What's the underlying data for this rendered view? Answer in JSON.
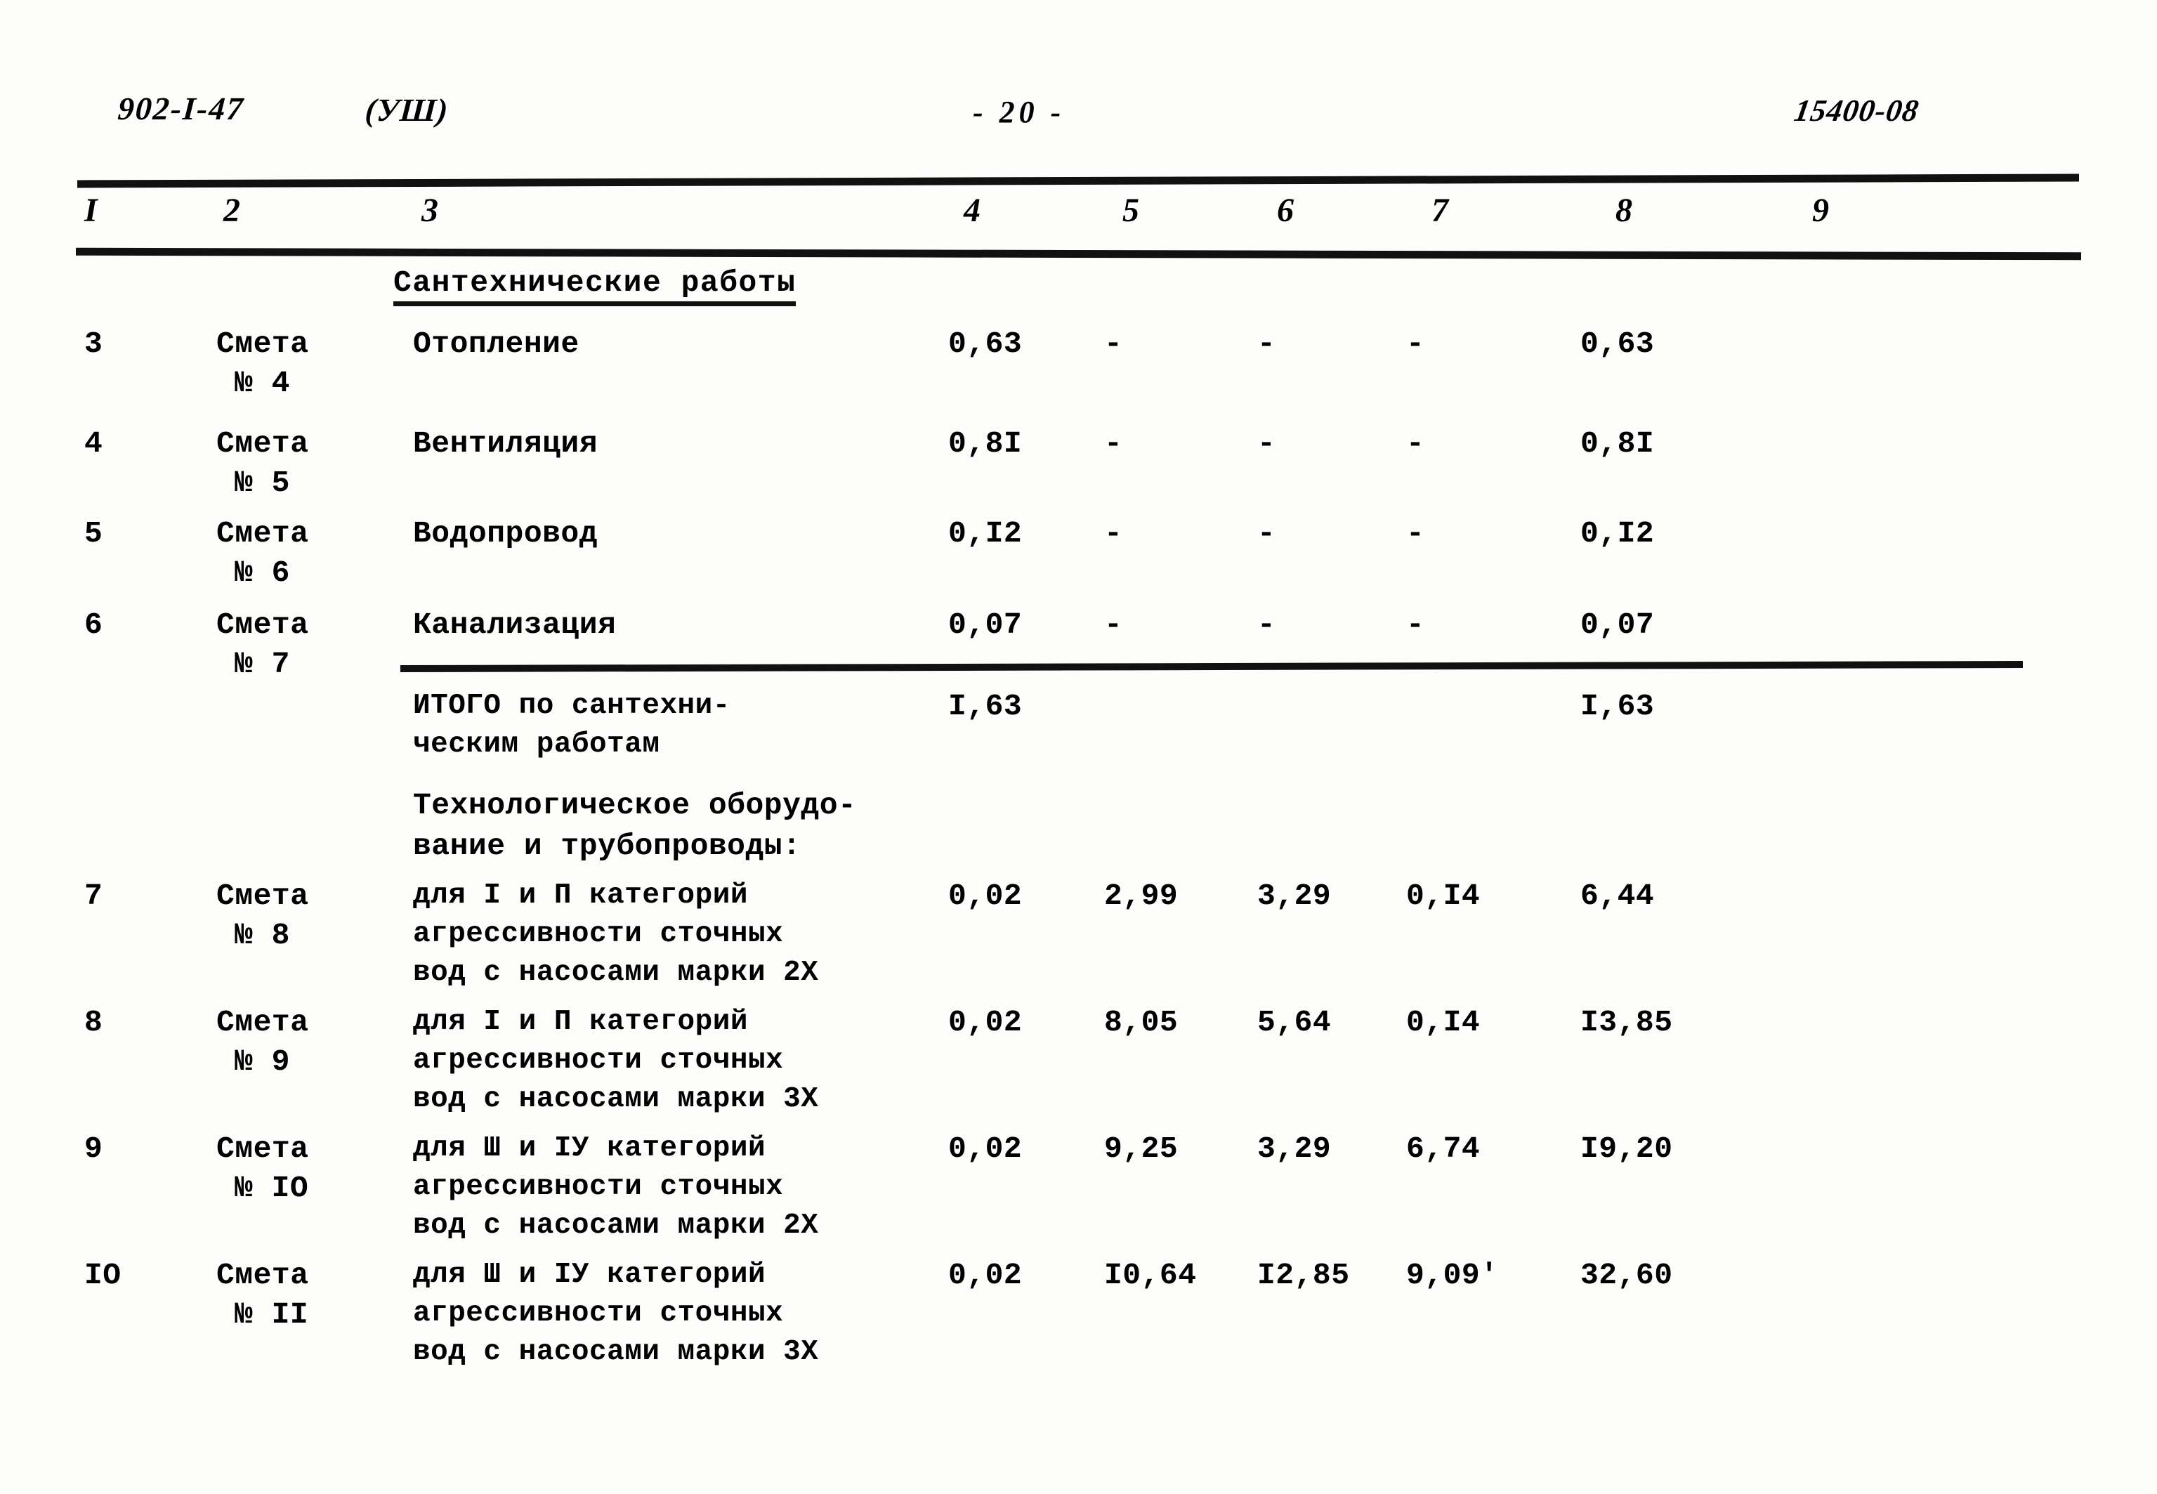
{
  "header": {
    "doc_code": "902-I-47",
    "series": "(УШ)",
    "page_number": "- 20 -",
    "stamp": "15400-08"
  },
  "table": {
    "column_headers": [
      "I",
      "2",
      "3",
      "4",
      "5",
      "6",
      "7",
      "8",
      "9"
    ],
    "section_title": "Сантехнические работы",
    "rows": [
      {
        "num": "3",
        "estimate_l1": "Смета",
        "estimate_l2": "№ 4",
        "desc": "Отопление",
        "c4": "0,63",
        "c5": "-",
        "c6": "-",
        "c7": "-",
        "c8": "0,63",
        "c9": ""
      },
      {
        "num": "4",
        "estimate_l1": "Смета",
        "estimate_l2": "№ 5",
        "desc": "Вентиляция",
        "c4": "0,8I",
        "c5": "-",
        "c6": "-",
        "c7": "-",
        "c8": "0,8I",
        "c9": ""
      },
      {
        "num": "5",
        "estimate_l1": "Смета",
        "estimate_l2": "№ 6",
        "desc": "Водопровод",
        "c4": "0,I2",
        "c5": "-",
        "c6": "-",
        "c7": "-",
        "c8": "0,I2",
        "c9": ""
      },
      {
        "num": "6",
        "estimate_l1": "Смета",
        "estimate_l2": "№ 7",
        "desc": "Канализация",
        "c4": "0,07",
        "c5": "-",
        "c6": "-",
        "c7": "-",
        "c8": "0,07",
        "c9": ""
      }
    ],
    "total_santeh": {
      "label": "ИТОГО по сантехни-\nческим работам",
      "c4": "I,63",
      "c8": "I,63"
    },
    "tech_heading": "Технологическое оборудо-\nвание и трубопроводы:",
    "tech_rows": [
      {
        "num": "7",
        "estimate_l1": "Смета",
        "estimate_l2": "№ 8",
        "desc": "для I и П категорий\nагрессивности сточных\nвод с насосами марки 2Х",
        "c4": "0,02",
        "c5": "2,99",
        "c6": "3,29",
        "c7": "0,I4",
        "c8": "6,44",
        "c9": ""
      },
      {
        "num": "8",
        "estimate_l1": "Смета",
        "estimate_l2": "№ 9",
        "desc": "для I и П категорий\nагрессивности сточных\nвод с насосами марки 3Х",
        "c4": "0,02",
        "c5": "8,05",
        "c6": "5,64",
        "c7": "0,I4",
        "c8": "I3,85",
        "c9": ""
      },
      {
        "num": "9",
        "estimate_l1": "Смета",
        "estimate_l2": "№ IO",
        "desc": "для Ш и IУ категорий\nагрессивности сточных\nвод с насосами марки 2Х",
        "c4": "0,02",
        "c5": "9,25",
        "c6": "3,29",
        "c7": "6,74",
        "c8": "I9,20",
        "c9": ""
      },
      {
        "num": "IO",
        "estimate_l1": "Смета",
        "estimate_l2": "№ II",
        "desc": "для Ш и IУ категорий\nагрессивности сточных\nвод с насосами марки 3Х",
        "c4": "0,02",
        "c5": "I0,64",
        "c6": "I2,85",
        "c7": "9,09'",
        "c8": "32,60",
        "c9": ""
      }
    ]
  }
}
